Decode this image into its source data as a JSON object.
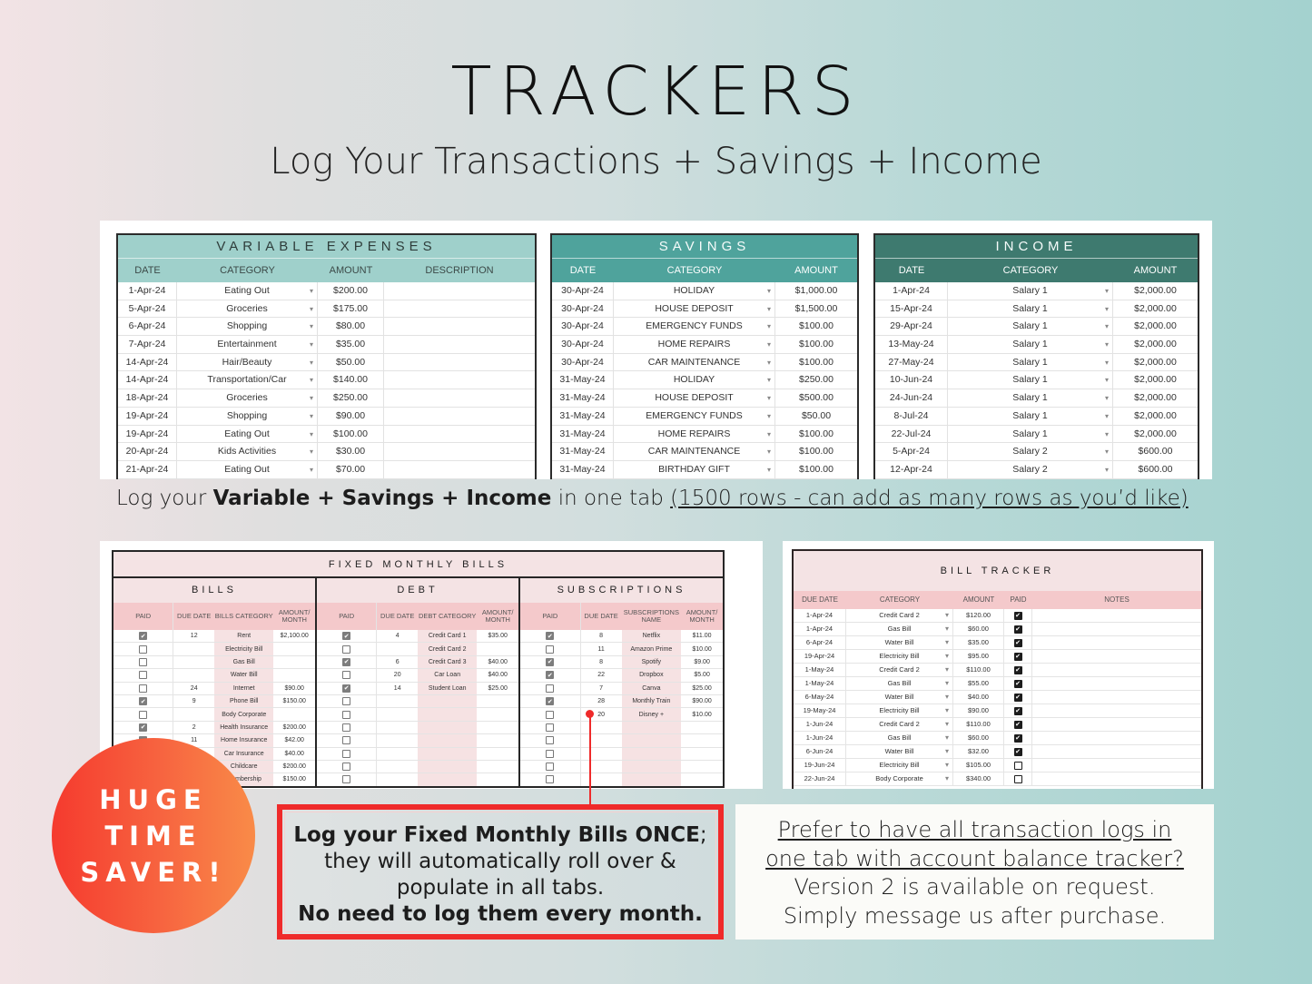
{
  "header": {
    "title": "TRACKERS",
    "subtitle": "Log Your Transactions + Savings + Income"
  },
  "colors": {
    "variable_header": "#9fd0cb",
    "savings_header": "#4fa39c",
    "income_header": "#3e7a6f",
    "fixed_pink_light": "#f4e3e4",
    "fixed_pink_header": "#f4c9cb",
    "badge_orange": "#f76540",
    "callout_red": "#ef2a2a"
  },
  "variable_expenses": {
    "title": "VARIABLE EXPENSES",
    "columns": [
      "DATE",
      "CATEGORY",
      "AMOUNT",
      "DESCRIPTION"
    ],
    "rows": [
      {
        "date": "1-Apr-24",
        "category": "Eating Out",
        "amount": "$200.00",
        "description": ""
      },
      {
        "date": "5-Apr-24",
        "category": "Groceries",
        "amount": "$175.00",
        "description": ""
      },
      {
        "date": "6-Apr-24",
        "category": "Shopping",
        "amount": "$80.00",
        "description": ""
      },
      {
        "date": "7-Apr-24",
        "category": "Entertainment",
        "amount": "$35.00",
        "description": ""
      },
      {
        "date": "14-Apr-24",
        "category": "Hair/Beauty",
        "amount": "$50.00",
        "description": ""
      },
      {
        "date": "14-Apr-24",
        "category": "Transportation/Car",
        "amount": "$140.00",
        "description": ""
      },
      {
        "date": "18-Apr-24",
        "category": "Groceries",
        "amount": "$250.00",
        "description": ""
      },
      {
        "date": "19-Apr-24",
        "category": "Shopping",
        "amount": "$90.00",
        "description": ""
      },
      {
        "date": "19-Apr-24",
        "category": "Eating Out",
        "amount": "$100.00",
        "description": ""
      },
      {
        "date": "20-Apr-24",
        "category": "Kids Activities",
        "amount": "$30.00",
        "description": ""
      },
      {
        "date": "21-Apr-24",
        "category": "Eating Out",
        "amount": "$70.00",
        "description": ""
      }
    ]
  },
  "savings": {
    "title": "SAVINGS",
    "columns": [
      "DATE",
      "CATEGORY",
      "AMOUNT"
    ],
    "rows": [
      {
        "date": "30-Apr-24",
        "category": "HOLIDAY",
        "amount": "$1,000.00"
      },
      {
        "date": "30-Apr-24",
        "category": "HOUSE DEPOSIT",
        "amount": "$1,500.00"
      },
      {
        "date": "30-Apr-24",
        "category": "EMERGENCY FUNDS",
        "amount": "$100.00"
      },
      {
        "date": "30-Apr-24",
        "category": "HOME REPAIRS",
        "amount": "$100.00"
      },
      {
        "date": "30-Apr-24",
        "category": "CAR MAINTENANCE",
        "amount": "$100.00"
      },
      {
        "date": "31-May-24",
        "category": "HOLIDAY",
        "amount": "$250.00"
      },
      {
        "date": "31-May-24",
        "category": "HOUSE DEPOSIT",
        "amount": "$500.00"
      },
      {
        "date": "31-May-24",
        "category": "EMERGENCY FUNDS",
        "amount": "$50.00"
      },
      {
        "date": "31-May-24",
        "category": "HOME REPAIRS",
        "amount": "$100.00"
      },
      {
        "date": "31-May-24",
        "category": "CAR MAINTENANCE",
        "amount": "$100.00"
      },
      {
        "date": "31-May-24",
        "category": "BIRTHDAY GIFT",
        "amount": "$100.00"
      }
    ]
  },
  "income": {
    "title": "INCOME",
    "columns": [
      "DATE",
      "CATEGORY",
      "AMOUNT"
    ],
    "rows": [
      {
        "date": "1-Apr-24",
        "category": "Salary 1",
        "amount": "$2,000.00"
      },
      {
        "date": "15-Apr-24",
        "category": "Salary 1",
        "amount": "$2,000.00"
      },
      {
        "date": "29-Apr-24",
        "category": "Salary 1",
        "amount": "$2,000.00"
      },
      {
        "date": "13-May-24",
        "category": "Salary 1",
        "amount": "$2,000.00"
      },
      {
        "date": "27-May-24",
        "category": "Salary 1",
        "amount": "$2,000.00"
      },
      {
        "date": "10-Jun-24",
        "category": "Salary 1",
        "amount": "$2,000.00"
      },
      {
        "date": "24-Jun-24",
        "category": "Salary 1",
        "amount": "$2,000.00"
      },
      {
        "date": "8-Jul-24",
        "category": "Salary 1",
        "amount": "$2,000.00"
      },
      {
        "date": "22-Jul-24",
        "category": "Salary 1",
        "amount": "$2,000.00"
      },
      {
        "date": "5-Apr-24",
        "category": "Salary 2",
        "amount": "$600.00"
      },
      {
        "date": "12-Apr-24",
        "category": "Salary 2",
        "amount": "$600.00"
      }
    ]
  },
  "caption_top": {
    "prefix": "Log your ",
    "bold": "Variable + Savings + Income",
    "middle": " in one tab ",
    "underlined": "(1500 rows - can add as many rows as you’d like)"
  },
  "fixed_monthly_bills": {
    "title": "FIXED MONTHLY BILLS",
    "sections": [
      {
        "title": "BILLS",
        "columns": [
          "PAID",
          "DUE DATE",
          "BILLS CATEGORY",
          "AMOUNT/ MONTH"
        ],
        "rows": [
          {
            "paid": true,
            "due": "12",
            "category": "Rent",
            "amount": "$2,100.00"
          },
          {
            "paid": false,
            "due": "",
            "category": "Electricity Bill",
            "amount": ""
          },
          {
            "paid": false,
            "due": "",
            "category": "Gas Bill",
            "amount": ""
          },
          {
            "paid": false,
            "due": "",
            "category": "Water Bill",
            "amount": ""
          },
          {
            "paid": false,
            "due": "24",
            "category": "Internet",
            "amount": "$90.00"
          },
          {
            "paid": true,
            "due": "9",
            "category": "Phone Bill",
            "amount": "$150.00"
          },
          {
            "paid": false,
            "due": "",
            "category": "Body Corporate",
            "amount": ""
          },
          {
            "paid": true,
            "due": "2",
            "category": "Health Insurance",
            "amount": "$200.00"
          },
          {
            "paid": true,
            "due": "11",
            "category": "Home Insurance",
            "amount": "$42.00"
          },
          {
            "paid": false,
            "due": "",
            "category": "Car Insurance",
            "amount": "$40.00"
          },
          {
            "paid": false,
            "due": "",
            "category": "Childcare",
            "amount": "$200.00"
          },
          {
            "paid": false,
            "due": "",
            "category": "Membership",
            "amount": "$150.00"
          }
        ]
      },
      {
        "title": "DEBT",
        "columns": [
          "PAID",
          "DUE DATE",
          "DEBT CATEGORY",
          "AMOUNT/ MONTH"
        ],
        "rows": [
          {
            "paid": true,
            "due": "4",
            "category": "Credit Card 1",
            "amount": "$35.00"
          },
          {
            "paid": false,
            "due": "",
            "category": "Credit Card 2",
            "amount": ""
          },
          {
            "paid": true,
            "due": "6",
            "category": "Credit Card 3",
            "amount": "$40.00"
          },
          {
            "paid": false,
            "due": "20",
            "category": "Car Loan",
            "amount": "$40.00"
          },
          {
            "paid": true,
            "due": "14",
            "category": "Student Loan",
            "amount": "$25.00"
          },
          {
            "paid": false,
            "due": "",
            "category": "",
            "amount": ""
          },
          {
            "paid": false,
            "due": "",
            "category": "",
            "amount": ""
          },
          {
            "paid": false,
            "due": "",
            "category": "",
            "amount": ""
          },
          {
            "paid": false,
            "due": "",
            "category": "",
            "amount": ""
          },
          {
            "paid": false,
            "due": "",
            "category": "",
            "amount": ""
          },
          {
            "paid": false,
            "due": "",
            "category": "",
            "amount": ""
          },
          {
            "paid": false,
            "due": "",
            "category": "",
            "amount": ""
          }
        ]
      },
      {
        "title": "SUBSCRIPTIONS",
        "columns": [
          "PAID",
          "DUE DATE",
          "SUBSCRIPTIONS NAME",
          "AMOUNT/ MONTH"
        ],
        "rows": [
          {
            "paid": true,
            "due": "8",
            "category": "Netflix",
            "amount": "$11.00"
          },
          {
            "paid": false,
            "due": "11",
            "category": "Amazon Prime",
            "amount": "$10.00"
          },
          {
            "paid": true,
            "due": "8",
            "category": "Spotify",
            "amount": "$9.00"
          },
          {
            "paid": true,
            "due": "22",
            "category": "Dropbox",
            "amount": "$5.00"
          },
          {
            "paid": false,
            "due": "7",
            "category": "Canva",
            "amount": "$25.00"
          },
          {
            "paid": true,
            "due": "28",
            "category": "Monthly Train",
            "amount": "$90.00"
          },
          {
            "paid": false,
            "due": "20",
            "category": "Disney +",
            "amount": "$10.00"
          },
          {
            "paid": false,
            "due": "",
            "category": "",
            "amount": ""
          },
          {
            "paid": false,
            "due": "",
            "category": "",
            "amount": ""
          },
          {
            "paid": false,
            "due": "",
            "category": "",
            "amount": ""
          },
          {
            "paid": false,
            "due": "",
            "category": "",
            "amount": ""
          },
          {
            "paid": false,
            "due": "",
            "category": "",
            "amount": ""
          }
        ]
      }
    ]
  },
  "bill_tracker": {
    "title": "BILL TRACKER",
    "columns": [
      "DUE DATE",
      "CATEGORY",
      "AMOUNT",
      "PAID",
      "NOTES"
    ],
    "rows": [
      {
        "date": "1-Apr-24",
        "category": "Credit Card 2",
        "amount": "$120.00",
        "paid": true,
        "notes": ""
      },
      {
        "date": "1-Apr-24",
        "category": "Gas Bill",
        "amount": "$60.00",
        "paid": true,
        "notes": ""
      },
      {
        "date": "6-Apr-24",
        "category": "Water Bill",
        "amount": "$35.00",
        "paid": true,
        "notes": ""
      },
      {
        "date": "19-Apr-24",
        "category": "Electricity Bill",
        "amount": "$95.00",
        "paid": true,
        "notes": ""
      },
      {
        "date": "1-May-24",
        "category": "Credit Card 2",
        "amount": "$110.00",
        "paid": true,
        "notes": ""
      },
      {
        "date": "1-May-24",
        "category": "Gas Bill",
        "amount": "$55.00",
        "paid": true,
        "notes": ""
      },
      {
        "date": "6-May-24",
        "category": "Water Bill",
        "amount": "$40.00",
        "paid": true,
        "notes": ""
      },
      {
        "date": "19-May-24",
        "category": "Electricity Bill",
        "amount": "$90.00",
        "paid": true,
        "notes": ""
      },
      {
        "date": "1-Jun-24",
        "category": "Credit Card 2",
        "amount": "$110.00",
        "paid": true,
        "notes": ""
      },
      {
        "date": "1-Jun-24",
        "category": "Gas Bill",
        "amount": "$60.00",
        "paid": true,
        "notes": ""
      },
      {
        "date": "6-Jun-24",
        "category": "Water Bill",
        "amount": "$32.00",
        "paid": true,
        "notes": ""
      },
      {
        "date": "19-Jun-24",
        "category": "Electricity Bill",
        "amount": "$105.00",
        "paid": false,
        "notes": ""
      },
      {
        "date": "22-Jun-24",
        "category": "Body Corporate",
        "amount": "$340.00",
        "paid": false,
        "notes": ""
      }
    ]
  },
  "badge": {
    "lines": [
      "HUGE",
      "TIME",
      "SAVER!"
    ]
  },
  "callout": {
    "bold_line": "Log your Fixed Monthly Bills ONCE",
    "semicolon": ";",
    "line2": "they will  automatically roll over &",
    "line3": "populate in all tabs.",
    "bold_last": "No need to log them every month."
  },
  "version_note": {
    "underlined_1": "Prefer to have all transaction logs in",
    "underlined_2": "one tab with account balance tracker?",
    "line3": "Version 2 is available on request.",
    "line4": "Simply message us after purchase."
  },
  "icons": {
    "dropdown": "▾",
    "check": "✔"
  }
}
